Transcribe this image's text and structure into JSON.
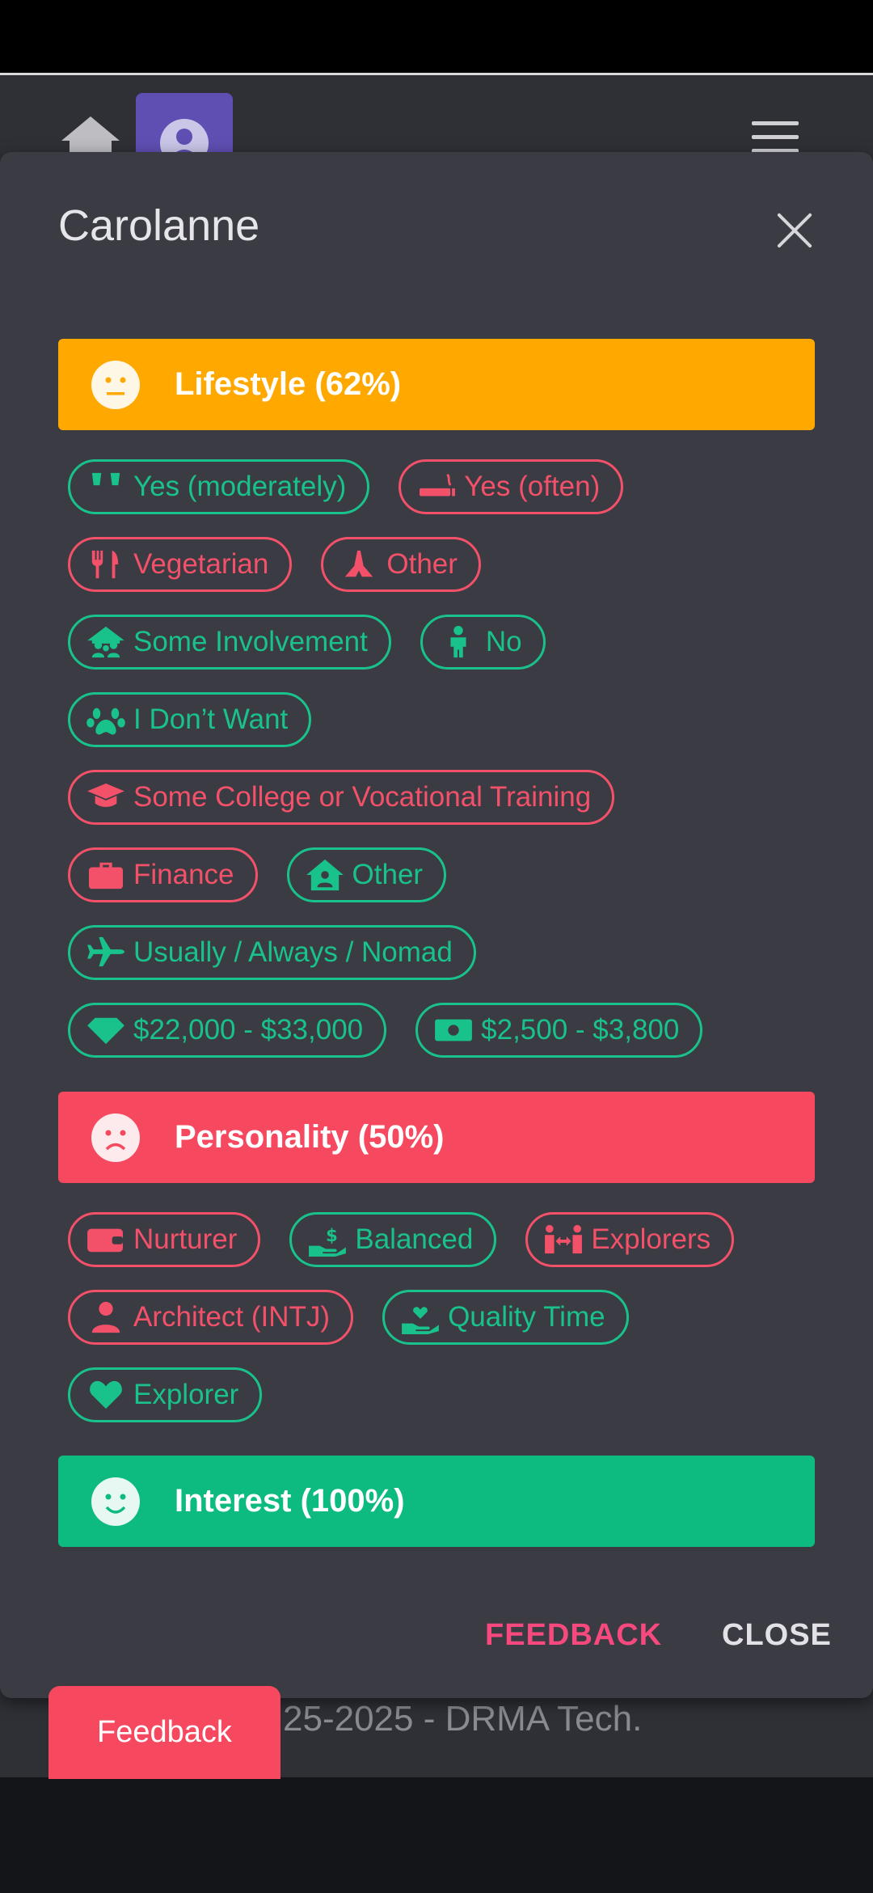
{
  "modal": {
    "title": "Carolanne",
    "sections": {
      "lifestyle": {
        "label": "Lifestyle (62%)",
        "color": "#ffa800",
        "mood": "neutral"
      },
      "personality": {
        "label": "Personality (50%)",
        "color": "#f6485f",
        "mood": "sad"
      },
      "interest": {
        "label": "Interest (100%)",
        "color": "#0dba7f",
        "mood": "happy"
      }
    },
    "lifestyle_chips": [
      {
        "label": "Yes (moderately)",
        "icon": "glasses-cheers-icon",
        "color": "green"
      },
      {
        "label": "Yes (often)",
        "icon": "smoking-icon",
        "color": "red"
      },
      {
        "label": "Vegetarian",
        "icon": "utensils-icon",
        "color": "red"
      },
      {
        "label": "Other",
        "icon": "praying-hands-icon",
        "color": "red"
      },
      {
        "label": "Some Involvement",
        "icon": "family-house-icon",
        "color": "green"
      },
      {
        "label": "No",
        "icon": "child-icon",
        "color": "green"
      },
      {
        "label": "I Don’t Want",
        "icon": "paw-icon",
        "color": "green"
      },
      {
        "label": "Some College or Vocational Training",
        "icon": "graduation-cap-icon",
        "color": "red"
      },
      {
        "label": "Finance",
        "icon": "briefcase-icon",
        "color": "red"
      },
      {
        "label": "Other",
        "icon": "house-user-icon",
        "color": "green"
      },
      {
        "label": "Usually / Always / Nomad",
        "icon": "plane-icon",
        "color": "green"
      },
      {
        "label": "$22,000 - $33,000",
        "icon": "gem-icon",
        "color": "green"
      },
      {
        "label": "$2,500 - $3,800",
        "icon": "money-bill-icon",
        "color": "green"
      }
    ],
    "personality_chips": [
      {
        "label": "Nurturer",
        "icon": "wallet-icon",
        "color": "red"
      },
      {
        "label": "Balanced",
        "icon": "hand-holding-dollar-icon",
        "color": "green"
      },
      {
        "label": "Explorers",
        "icon": "people-arrows-icon",
        "color": "red"
      },
      {
        "label": "Architect (INTJ)",
        "icon": "user-icon",
        "color": "red"
      },
      {
        "label": "Quality Time",
        "icon": "hand-holding-heart-icon",
        "color": "green"
      },
      {
        "label": "Explorer",
        "icon": "heart-icon",
        "color": "green"
      }
    ],
    "actions": {
      "feedback": "FEEDBACK",
      "close": "CLOSE"
    }
  },
  "page": {
    "footer_text": "25-2025 - DRMA Tech.",
    "floating_feedback": "Feedback"
  },
  "colors": {
    "green": "#19c28b",
    "red": "#f3516a",
    "feedback_pink": "#f6485f",
    "modal_bg": "#3a3b43"
  }
}
